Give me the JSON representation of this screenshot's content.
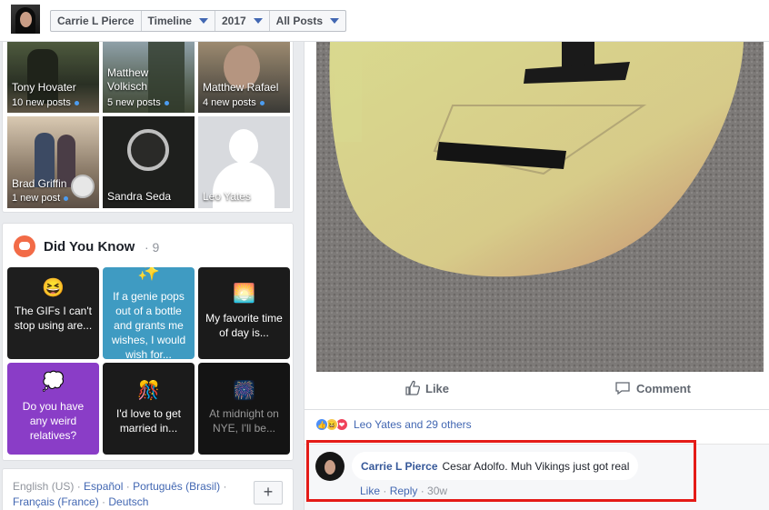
{
  "header": {
    "crumbs": [
      {
        "label": "Carrie L Pierce",
        "dropdown": false
      },
      {
        "label": "Timeline",
        "dropdown": true
      },
      {
        "label": "2017",
        "dropdown": true
      },
      {
        "label": "All Posts",
        "dropdown": true
      }
    ]
  },
  "friends": [
    {
      "name": "Tony Hovater",
      "posts": "10 new posts",
      "new": true
    },
    {
      "name": "Matthew\nVolkisch",
      "posts": "5 new posts",
      "new": true
    },
    {
      "name": "Matthew Rafael",
      "posts": "4 new posts",
      "new": true
    },
    {
      "name": "Brad Griffin",
      "posts": "1 new post",
      "new": true
    },
    {
      "name": "Sandra Seda",
      "posts": "",
      "new": false
    },
    {
      "name": "Leo Yates",
      "posts": "",
      "new": false
    }
  ],
  "did_you_know": {
    "title": "Did You Know",
    "count": "· 9",
    "questions": [
      {
        "text": "The GIFs I can't stop using are...",
        "emoji": "😆",
        "bg": "#1e1e1e"
      },
      {
        "text": "If a genie pops out of a bottle and grants me wishes, I would wish for...",
        "emoji": "✨",
        "bg": "#3f9bc2"
      },
      {
        "text": "My favorite time of day is...",
        "emoji": "🌅",
        "bg": "#1b1b1b"
      },
      {
        "text": "Do you have any weird relatives?",
        "emoji": "💭",
        "bg": "#8a3dc7"
      },
      {
        "text": "I'd love to get married in...",
        "emoji": "🎊",
        "bg": "#1b1b1b"
      },
      {
        "text": "At midnight on NYE, I'll be...",
        "emoji": "🎆",
        "bg": "#141414"
      }
    ]
  },
  "footer": {
    "current_language": "English (US)",
    "languages": [
      "Español",
      "Português (Brasil)",
      "Français (France)",
      "Deutsch"
    ],
    "add_button": "+"
  },
  "post": {
    "actions": {
      "like": "Like",
      "comment": "Comment"
    },
    "reactions_text": "Leo Yates and 29 others",
    "comment": {
      "author": "Carrie L Pierce",
      "text": "Cesar Adolfo. Muh Vikings just got real",
      "like": "Like",
      "reply": "Reply",
      "time": "30w"
    }
  },
  "colors": {
    "link": "#4267b2",
    "highlight": "#e41b17",
    "page_bg": "#e9ebee"
  }
}
